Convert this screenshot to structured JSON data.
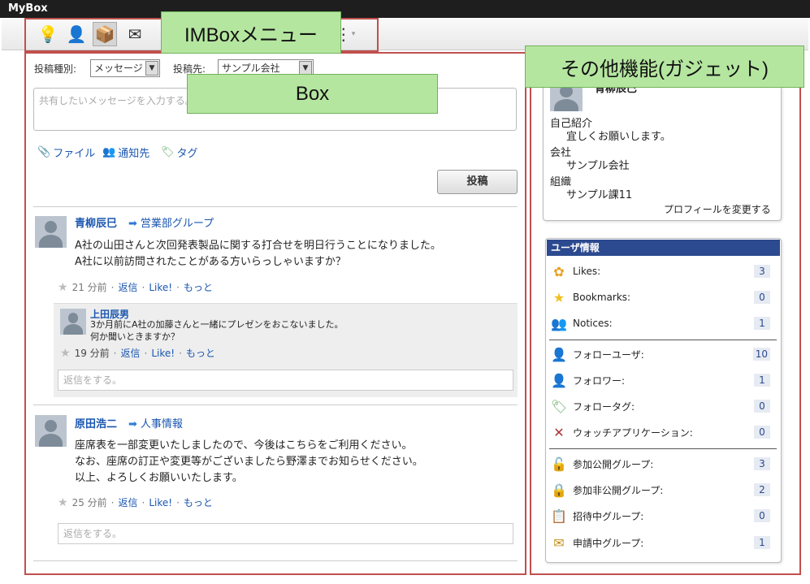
{
  "window": {
    "title": "MyBox"
  },
  "callouts": {
    "menu": "IMBoxメニュー",
    "box": "Box",
    "gadget": "その他機能(ガジェット)"
  },
  "compose": {
    "type_label": "投稿種別:",
    "type_value": "メッセージ",
    "dest_label": "投稿先:",
    "dest_value": "サンプル会社",
    "placeholder": "共有したいメッセージを入力する。",
    "file_label": "ファイル",
    "notify_label": "通知先",
    "tag_label": "タグ",
    "post_label": "投稿"
  },
  "posts": [
    {
      "user": "青柳辰巳",
      "group": "営業部グループ",
      "lines": [
        "A社の山田さんと次回発表製品に関する打合せを明日行うことになりました。",
        "A社に以前訪問されたことがある方いらっしゃいますか？"
      ],
      "time": "21 分前",
      "reply": "返信",
      "like": "Like!",
      "more": "もっと",
      "sub": {
        "user": "上田辰男",
        "lines": [
          "3か月前にA社の加藤さんと一緒にプレゼンをおこないました。",
          "何か聞いときますか？"
        ],
        "time": "19 分前",
        "reply": "返信",
        "like": "Like!",
        "more": "もっと"
      },
      "reply_placeholder": "返信をする。"
    },
    {
      "user": "原田浩二",
      "group": "人事情報",
      "lines": [
        "座席表を一部変更いたしましたので、今後はこちらをご利用ください。",
        "なお、座席の訂正や変更等がございましたら野澤までお知らせください。",
        "以上、よろしくお願いいたします。"
      ],
      "time": "25 分前",
      "reply": "返信",
      "like": "Like!",
      "more": "もっと",
      "reply_placeholder": "返信をする。"
    }
  ],
  "profile": {
    "name": "青柳辰巳",
    "intro_label": "自己紹介",
    "intro_value": "宜しくお願いします。",
    "company_label": "会社",
    "company_value": "サンプル会社",
    "org_label": "組織",
    "org_value": "サンプル課11",
    "edit_link": "プロフィールを変更する"
  },
  "user_info": {
    "title": "ユーザ情報",
    "items": [
      {
        "icon": "flower-icon",
        "label": "Likes:",
        "count": "3"
      },
      {
        "icon": "star-icon",
        "label": "Bookmarks:",
        "count": "0"
      },
      {
        "icon": "people-icon",
        "label": "Notices:",
        "count": "1"
      },
      {
        "icon": "follow-user-icon",
        "label": "フォローユーザ:",
        "count": "10"
      },
      {
        "icon": "follower-icon",
        "label": "フォロワー:",
        "count": "1"
      },
      {
        "icon": "tag-icon",
        "label": "フォロータグ:",
        "count": "0"
      },
      {
        "icon": "tools-icon",
        "label": "ウォッチアプリケーション:",
        "count": "0"
      },
      {
        "icon": "unlock-icon",
        "label": "参加公開グループ:",
        "count": "3"
      },
      {
        "icon": "lock-icon",
        "label": "参加非公開グループ:",
        "count": "2"
      },
      {
        "icon": "invite-icon",
        "label": "招待中グループ:",
        "count": "0"
      },
      {
        "icon": "mail-icon",
        "label": "申請中グループ:",
        "count": "1"
      }
    ]
  }
}
